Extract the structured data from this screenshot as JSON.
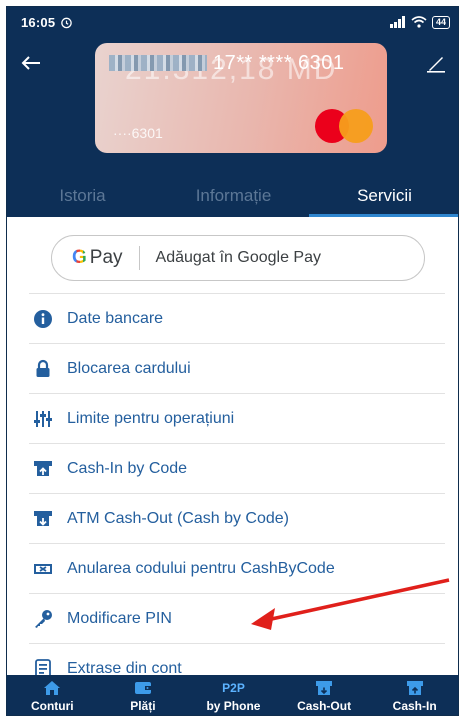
{
  "status_bar": {
    "time": "16:05",
    "battery": "44"
  },
  "header": {
    "card_number_suffix": "17** **** 6301",
    "card_ghost_balance": "21.312,18 MD",
    "card_ghost_number": "····6301"
  },
  "tabs": [
    {
      "label": "Istoria",
      "active": false
    },
    {
      "label": "Informație",
      "active": false
    },
    {
      "label": "Servicii",
      "active": true
    }
  ],
  "google_pay": {
    "brand": "Pay",
    "status": "Adăugat în Google Pay"
  },
  "services": [
    {
      "label": "Date bancare",
      "icon": "info-icon"
    },
    {
      "label": "Blocarea cardului",
      "icon": "lock-icon"
    },
    {
      "label": "Limite pentru operațiuni",
      "icon": "sliders-icon"
    },
    {
      "label": "Cash-In by Code",
      "icon": "cash-in-icon"
    },
    {
      "label": "ATM Cash-Out (Cash by Code)",
      "icon": "atm-cash-out-icon"
    },
    {
      "label": "Anularea codului pentru CashByCode",
      "icon": "cancel-code-icon"
    },
    {
      "label": "Modificare PIN",
      "icon": "key-icon"
    },
    {
      "label": "Extrase din cont",
      "icon": "statement-icon"
    }
  ],
  "bottom_nav": [
    {
      "label": "Conturi",
      "icon": "home-icon"
    },
    {
      "label": "Plăți",
      "icon": "wallet-icon"
    },
    {
      "label": "by Phone",
      "tag": "P2P"
    },
    {
      "label": "Cash-Out",
      "icon": "cash-out-icon"
    },
    {
      "label": "Cash-In",
      "icon": "cash-in-nav-icon"
    }
  ],
  "colors": {
    "header_bg": "#0d2f57",
    "link_blue": "#245f9e",
    "arrow_red": "#e0201b",
    "active_tab_underline": "#2f86cf"
  }
}
